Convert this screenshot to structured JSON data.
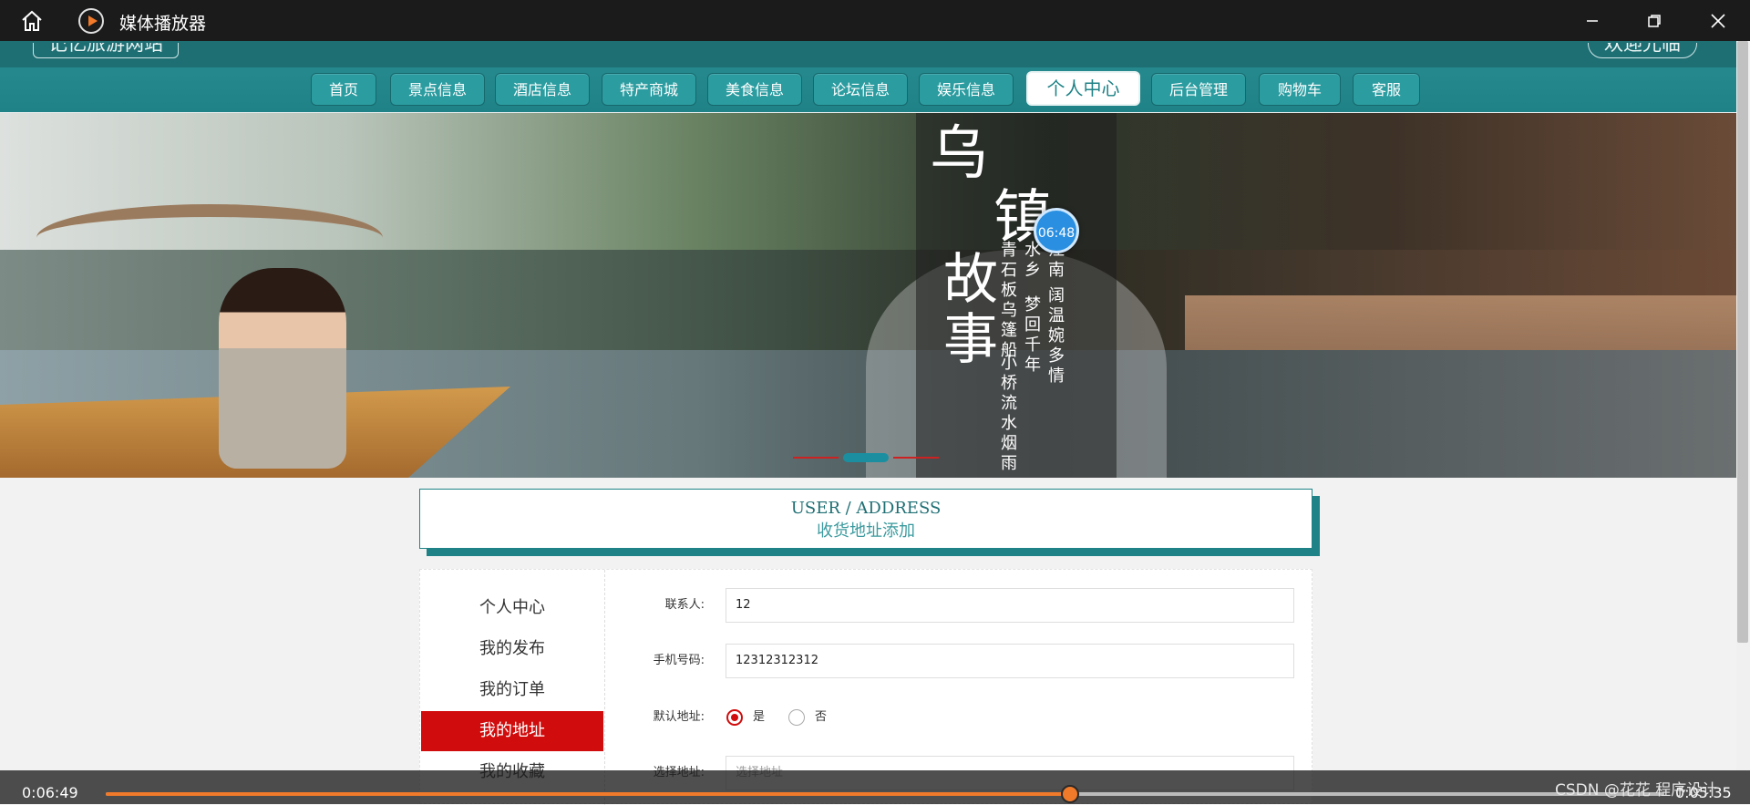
{
  "player": {
    "title": "媒体播放器",
    "elapsed": "0:06:49",
    "remaining": "0:05:35",
    "progress": 0.619,
    "minimize_icon": "minimize-icon",
    "restore_icon": "restore-icon",
    "close_icon": "close-icon",
    "accent_color": "#f07a2a"
  },
  "site": {
    "logo": "记忆旅游网站",
    "welcome": "欢迎光临",
    "brand_color": "#1f8286"
  },
  "nav": {
    "items": [
      "首页",
      "景点信息",
      "酒店信息",
      "特产商城",
      "美食信息",
      "论坛信息",
      "娱乐信息",
      "个人中心",
      "后台管理",
      "购物车",
      "客服"
    ],
    "active": "个人中心"
  },
  "banner": {
    "calligraphy_title_1": "乌",
    "calligraphy_title_2": "镇",
    "calligraphy_title_3": "故事",
    "poem_lines": [
      "青石板乌篷船",
      "小桥流水烟雨一",
      "水乡",
      "梦回千年",
      "江南",
      "阔温婉多情"
    ],
    "clock_badge": "06:48",
    "active_slide": 2
  },
  "page": {
    "title_en": "USER / ADDRESS",
    "title_zh": "收货地址添加"
  },
  "sidebar": {
    "items": [
      "个人中心",
      "我的发布",
      "我的订单",
      "我的地址",
      "我的收藏"
    ],
    "active": "我的地址"
  },
  "form": {
    "contact_label": "联系人:",
    "contact_value": "12",
    "phone_label": "手机号码:",
    "phone_value": "12312312312",
    "default_label": "默认地址:",
    "default_yes": "是",
    "default_no": "否",
    "default_selected": "是",
    "address_label": "选择地址:",
    "address_placeholder": "选择地址"
  },
  "watermark": "CSDN @花花 程序设计"
}
